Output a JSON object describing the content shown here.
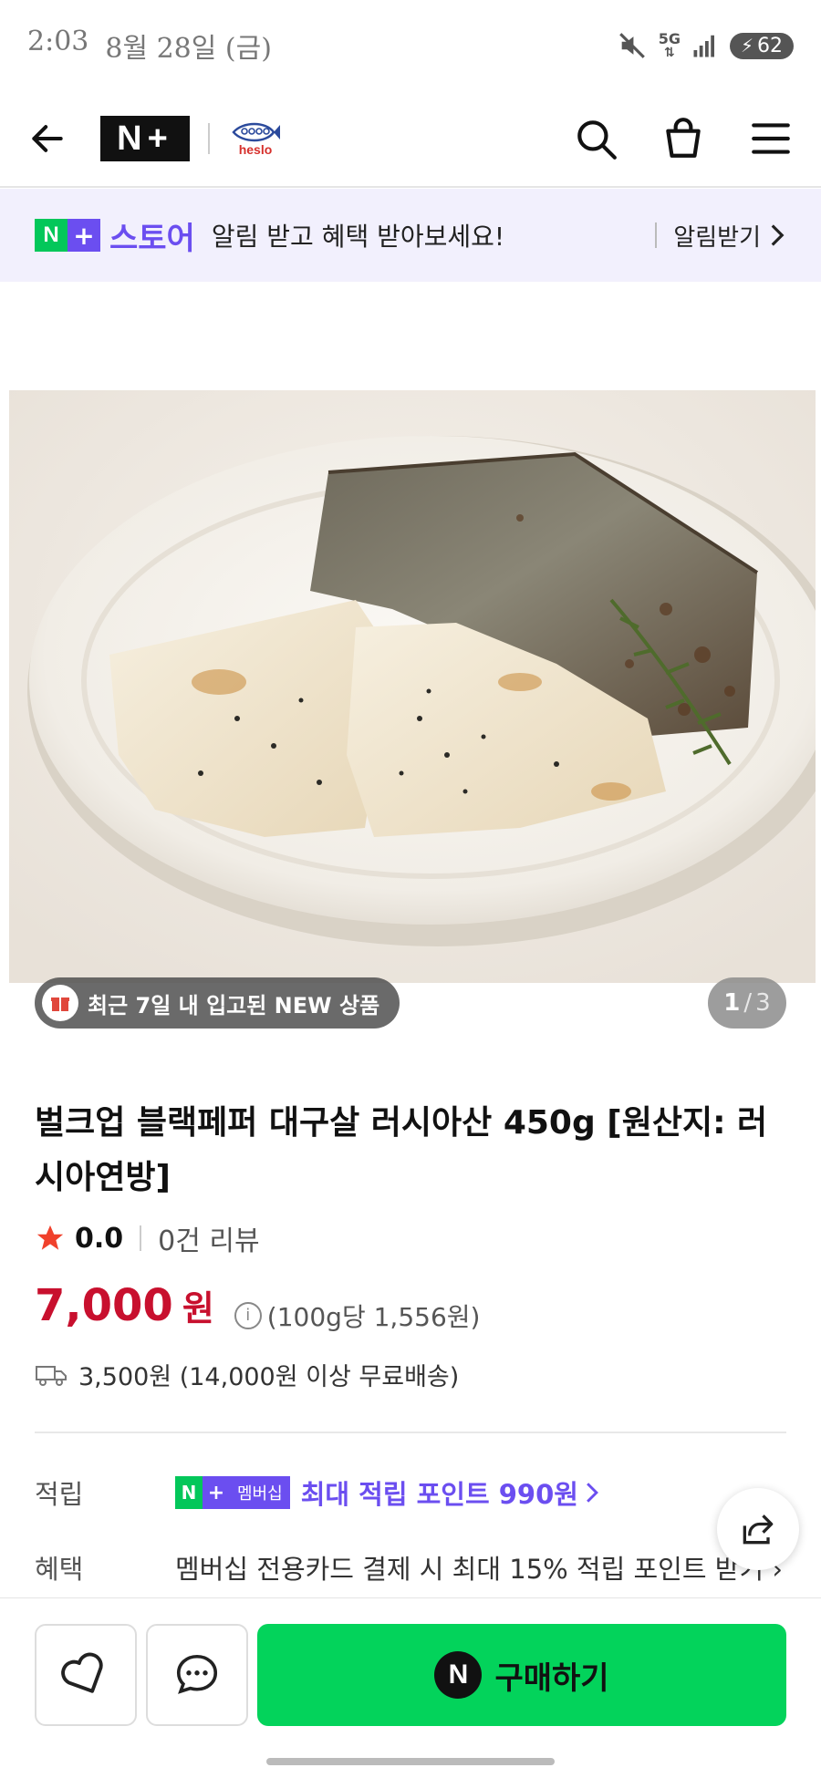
{
  "status_bar": {
    "time": "2:03",
    "date": "8월 28일 (금)",
    "network": "5G",
    "battery": "62"
  },
  "header": {
    "logo": "N+",
    "brand": "heslo"
  },
  "banner": {
    "store_label": "스토어",
    "message": "알림 받고 혜택 받아보세요!",
    "action": "알림받기"
  },
  "image": {
    "new_badge": "최근 7일 내 입고된 NEW 상품",
    "pager_current": "1",
    "pager_sep": "/",
    "pager_total": "3"
  },
  "product": {
    "title": "벌크업 블랙페퍼 대구살 러시아산 450g [원산지: 러시아연방]",
    "rating": "0.0",
    "review_count": "0건 리뷰",
    "price": "7,000",
    "price_unit": "원",
    "unit_price": "(100g당 1,556원)",
    "shipping": "3,500원 (14,000원 이상 무료배송)"
  },
  "rewards": {
    "label": "적립",
    "membership_badge": "멤버십",
    "text": "최대 적립 포인트 990원"
  },
  "benefits": {
    "label": "혜택",
    "text": "멤버십 전용카드 결제 시 최대 15% 적립 포인트 받기"
  },
  "bottom_bar": {
    "buy_label": "구매하기"
  },
  "colors": {
    "naver_green": "#03c75a",
    "naver_plus_purple": "#6b4ef0",
    "price_red": "#c8102e",
    "buy_button": "#03d35b"
  }
}
